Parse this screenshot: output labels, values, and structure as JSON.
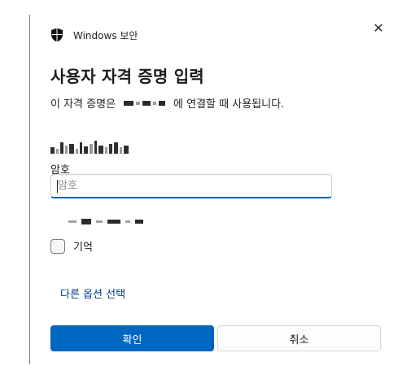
{
  "dialog": {
    "app_title": "Windows 보안",
    "close_glyph": "✕",
    "heading": "사용자 자격 증명 입력",
    "description_prefix": "이 자격 증명은",
    "description_suffix": "에 연결할 때 사용됩니다.",
    "password_label": "암호",
    "password_placeholder": "암호",
    "password_value": "",
    "remember_label": "기억",
    "remember_checked": false,
    "more_options_link": "다른 옵션 선택",
    "ok_button": "확인",
    "cancel_button": "취소"
  },
  "icons": {
    "app": "shield-icon",
    "close": "close-icon"
  },
  "colors": {
    "accent": "#0067c0",
    "link": "#003e92",
    "text": "#1b1b1b",
    "border": "#d6d6d6"
  }
}
